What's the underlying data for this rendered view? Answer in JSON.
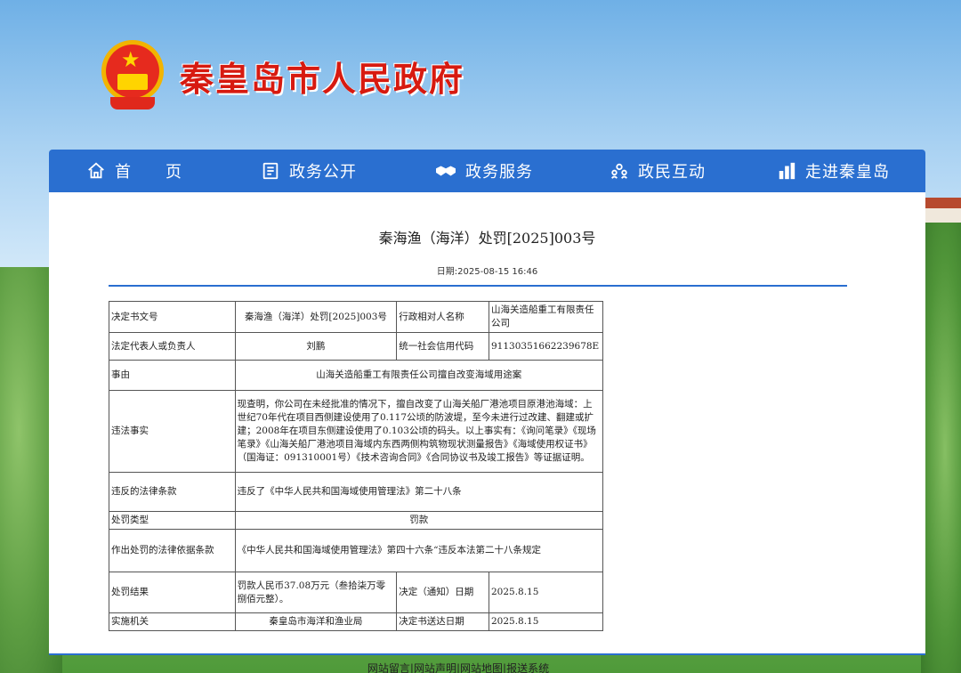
{
  "site": {
    "title": "秦皇岛市人民政府",
    "emblem_icon": "national-emblem-icon"
  },
  "colors": {
    "nav_bg": "#2a6fd0",
    "title_red": "#d71a10"
  },
  "nav": {
    "items": [
      {
        "label": "首　　页",
        "icon": "home-icon"
      },
      {
        "label": "政务公开",
        "icon": "document-list-icon"
      },
      {
        "label": "政务服务",
        "icon": "handshake-icon"
      },
      {
        "label": "政民互动",
        "icon": "people-icon"
      },
      {
        "label": "走进秦皇岛",
        "icon": "buildings-icon"
      }
    ]
  },
  "doc": {
    "title": "秦海渔（海洋）处罚[2025]003号",
    "date": "日期:2025-08-15 16:46"
  },
  "table": {
    "r1": {
      "l1": "决定书文号",
      "v1": "秦海渔（海洋）处罚[2025]003号",
      "l2": "行政相对人名称",
      "v2": "山海关造船重工有限责任公司"
    },
    "r2": {
      "l1": "法定代表人或负责人",
      "v1": "刘鹏",
      "l2": "统一社会信用代码",
      "v2": "91130351662239678E"
    },
    "r3": {
      "l": "事由",
      "v": "山海关造船重工有限责任公司擅自改变海域用途案"
    },
    "r4": {
      "l": "违法事实",
      "v": "现查明，你公司在未经批准的情况下，擅自改变了山海关船厂港池项目原港池海域：上世纪70年代在项目西侧建设使用了0.117公顷的防波堤，至今未进行过改建、翻建或扩建；2008年在项目东侧建设使用了0.103公顷的码头。以上事实有：《询问笔录》《现场笔录》《山海关船厂港池项目海域内东西两侧构筑物现状测量报告》《海域使用权证书》（国海证：091310001号）《技术咨询合同》《合同协议书及竣工报告》等证据证明。"
    },
    "r5": {
      "l": "违反的法律条款",
      "v": "违反了《中华人民共和国海域使用管理法》第二十八条"
    },
    "r6": {
      "l": "处罚类型",
      "v": "罚款"
    },
    "r7": {
      "l": "作出处罚的法律依据条款",
      "v": "《中华人民共和国海域使用管理法》第四十六条“违反本法第二十八条规定"
    },
    "r8": {
      "l1": "处罚结果",
      "v1": "罚款人民币37.08万元（叁拾柒万零捌佰元整）。",
      "l2": "决定（通知）日期",
      "v2": "2025.8.15"
    },
    "r9": {
      "l1": "实施机关",
      "v1": "秦皇岛市海洋和渔业局",
      "l2": "决定书送达日期",
      "v2": "2025.8.15"
    }
  },
  "footer": {
    "links": [
      "网站留言",
      "网站声明",
      "网站地图",
      "报送系统"
    ],
    "separator": " | "
  }
}
